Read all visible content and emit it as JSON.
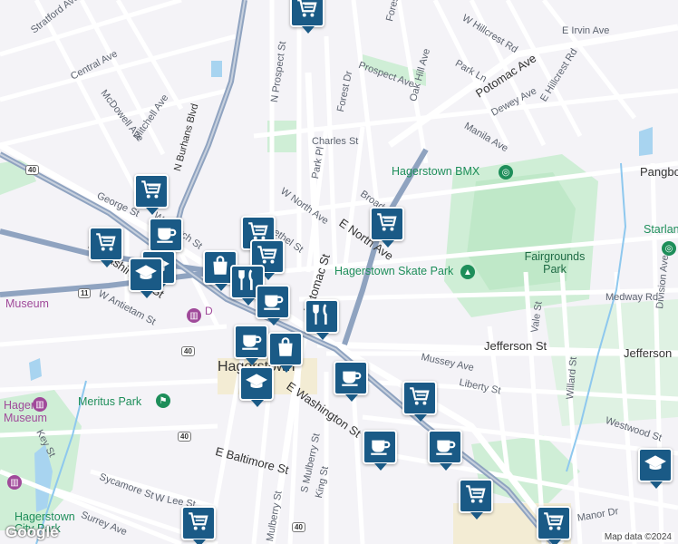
{
  "map": {
    "streets": [
      "Stratford Ave",
      "Central Ave",
      "McDowell Ave",
      "Mitchell Ave",
      "N Burhans Blvd",
      "N Prospect St",
      "Forest Dr",
      "Oak Hill Ave",
      "W Hillcrest Rd",
      "E Hillcrest Rd",
      "E Irvin Ave",
      "Potomac Ave",
      "Park Ln",
      "Prospect Ave",
      "Dewey Ave",
      "Manila Ave",
      "Charles St",
      "Park Pl",
      "W North Ave",
      "Broadway",
      "E North Ave",
      "Potomac St",
      "George St",
      "W Church St",
      "Bethel St",
      "W Washington St",
      "W Antietam St",
      "E Washington St",
      "Mussey Ave",
      "Liberty St",
      "Jefferson St",
      "Medway Rd",
      "Division Ave",
      "Vale St",
      "Willard St",
      "Westwood St",
      "E Baltimore St",
      "W Lee St",
      "Sycamore St",
      "Surrey Ave",
      "Key St",
      "S Mulberry St",
      "King St",
      "Manor Dr",
      "Mulberry St"
    ],
    "places": {
      "city": "Hagerstown",
      "bmx": "Hagerstown BMX",
      "skate_park": "Hagerstown Skate Park",
      "fairgrounds": "Fairgrounds Park",
      "meritus": "Meritus Park",
      "museum_left": "Museum",
      "museum_small": "Hager Museum",
      "pangborn": "Pangbo",
      "starland": "Starlan",
      "jefferson_right": "Jefferson",
      "hagerstown_park": "Hagerstown City Park",
      "d_label": "D"
    },
    "shields": [
      "40",
      "11",
      "40",
      "40",
      "40"
    ],
    "attribution": "Map data ©2024",
    "logo": "Google",
    "pins": [
      {
        "icon": "cart-icon"
      },
      {
        "icon": "cart-icon"
      },
      {
        "icon": "cart-icon"
      },
      {
        "icon": "coffee-icon"
      },
      {
        "icon": "school-icon"
      },
      {
        "icon": "cart-icon"
      },
      {
        "icon": "cart-icon"
      },
      {
        "icon": "bag-icon"
      },
      {
        "icon": "restaurant-icon"
      },
      {
        "icon": "coffee-icon"
      },
      {
        "icon": "coffee-icon"
      },
      {
        "icon": "restaurant-icon"
      },
      {
        "icon": "bag-icon"
      },
      {
        "icon": "school-icon"
      },
      {
        "icon": "coffee-icon"
      },
      {
        "icon": "cart-icon"
      },
      {
        "icon": "coffee-icon"
      },
      {
        "icon": "coffee-icon"
      },
      {
        "icon": "cart-icon"
      },
      {
        "icon": "cart-icon"
      },
      {
        "icon": "cart-icon"
      },
      {
        "icon": "school-icon"
      },
      {
        "icon": "cart-icon"
      },
      {
        "icon": "school-icon"
      }
    ]
  }
}
